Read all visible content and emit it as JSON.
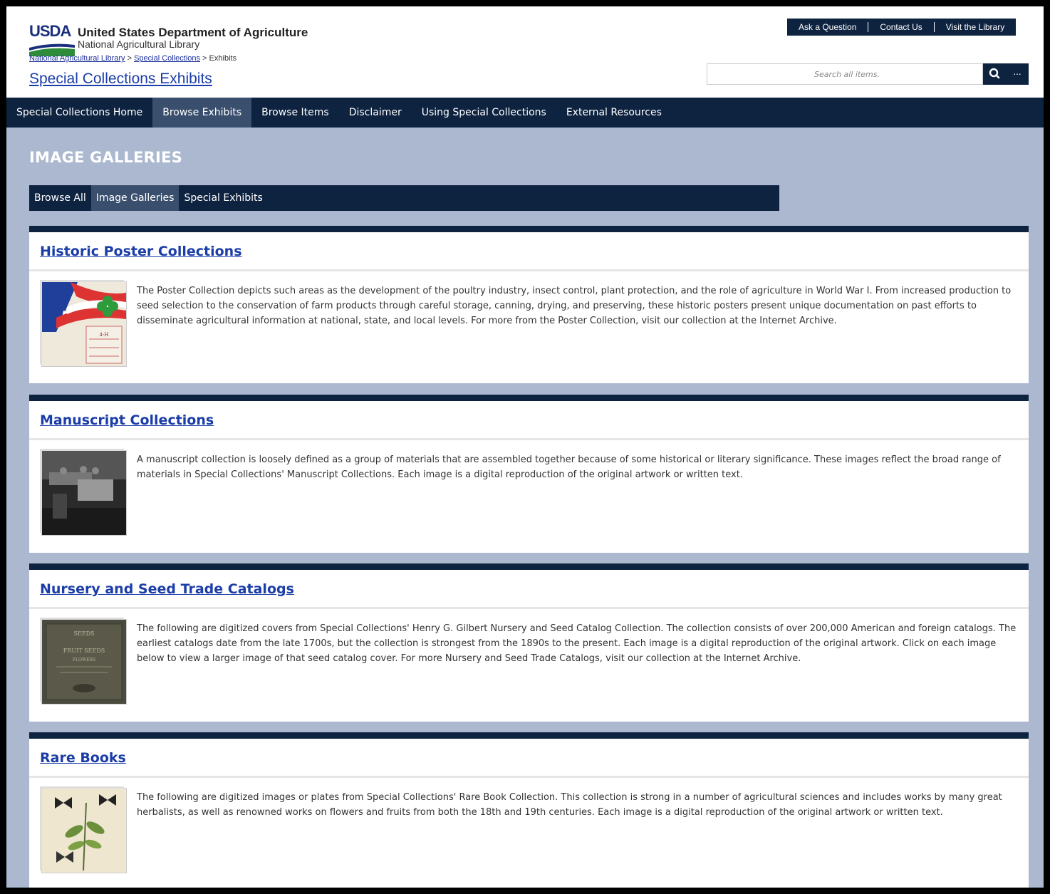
{
  "header": {
    "logo_text": "USDA",
    "department": "United States Department of Agriculture",
    "library": "National Agricultural Library",
    "breadcrumb": {
      "link1": "National Agricultural Library",
      "sep1": " > ",
      "link2": "Special Collections",
      "sep2": " > ",
      "current": "Exhibits"
    },
    "site_title": "Special Collections Exhibits",
    "utility_links": [
      "Ask a Question",
      "Contact Us",
      "Visit the Library"
    ],
    "search": {
      "placeholder": "Search all items.",
      "more_label": "..."
    }
  },
  "nav": {
    "items": [
      "Special Collections Home",
      "Browse Exhibits",
      "Browse Items",
      "Disclaimer",
      "Using Special Collections",
      "External Resources"
    ],
    "active": "Browse Exhibits"
  },
  "page": {
    "heading": "IMAGE GALLERIES",
    "subnav": [
      "Browse All",
      "Image Galleries",
      "Special Exhibits"
    ],
    "subnav_active": "Image Galleries"
  },
  "galleries": [
    {
      "title": "Historic Poster Collections",
      "description": "The Poster Collection depicts such areas as the development of the poultry industry, insect control, plant protection, and the role of agriculture in World War I. From increased production to seed selection to the conservation of farm products through careful storage, canning, drying, and preserving, these historic posters present unique documentation on past efforts to disseminate agricultural information at national, state, and local levels. For more from the Poster Collection, visit our collection at the Internet Archive.",
      "thumb_text": "4-H FOR THE YOUTH OF AMERICA"
    },
    {
      "title": "Manuscript Collections",
      "description": "A manuscript collection is loosely defined as a group of materials that are assembled together because of some historical or literary significance. These images reflect the broad range of materials in Special Collections' Manuscript Collections. Each image is a digital reproduction of the original artwork or written text."
    },
    {
      "title": "Nursery and Seed Trade Catalogs",
      "description": "The following are digitized covers from Special Collections' Henry G. Gilbert Nursery and Seed Catalog Collection. The collection consists of over 200,000 American and foreign catalogs. The earliest catalogs date from the late 1700s, but the collection is strongest from the 1890s to the present. Each image is a digital reproduction of the original artwork. Click on each image below to view a larger image of that seed catalog cover. For more Nursery and Seed Trade Catalogs, visit our collection at the Internet Archive.",
      "thumb_text": "SEEDS FRUIT SEEDS FLOWERS"
    },
    {
      "title": "Rare Books",
      "description": "The following are digitized images or plates from Special Collections' Rare Book Collection. This collection is strong in a number of agricultural sciences and includes works by many great herbalists, as well as renowned works on flowers and fruits from both the 18th and 19th centuries. Each image is a digital reproduction of the original artwork or written text."
    }
  ],
  "colors": {
    "navy": "#0e2340",
    "active_nav": "#3a4f6d",
    "page_bg": "#abb8cf",
    "link": "#1b3da8"
  }
}
